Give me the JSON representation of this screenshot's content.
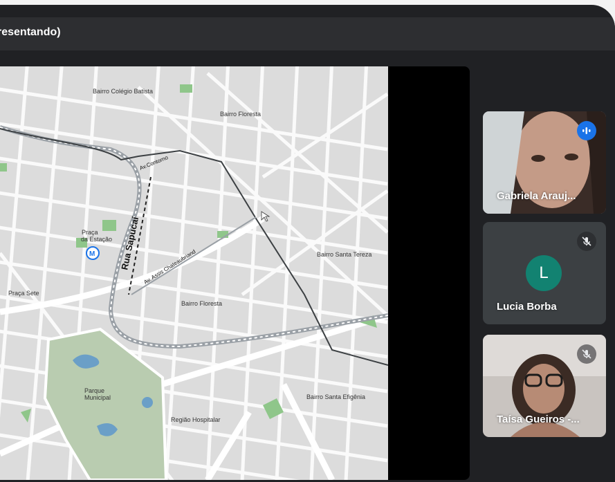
{
  "window": {
    "title": "resentando)"
  },
  "map": {
    "labels": {
      "colegio_batista": "Bairro Colégio Batista",
      "floresta_top": "Bairro Floresta",
      "av_contorno": "Av.Contorno",
      "rua_sapucai": "Rua Sapucaí",
      "praca_estacao": [
        "Praça",
        "da Estação"
      ],
      "metro": "M",
      "av_assis": "Av. Assis Chateaubriand",
      "santa_tereza": "Bairro Santa Tereza",
      "praca_sete": "Praça Sete",
      "floresta_mid": "Bairro Floresta",
      "parque": [
        "Parque",
        "Municipal"
      ],
      "santa_efigenia": "Bairro Santa Efigênia",
      "regiao_hospitalar": "Região Hospitalar"
    }
  },
  "participants": [
    {
      "name": "Gabriela Arauj...",
      "speaking": true,
      "icon": "speaking-icon"
    },
    {
      "name": "Lucia Borba",
      "initial": "L",
      "muted": true,
      "icon": "mic-off-icon",
      "avatar_color": "#128271"
    },
    {
      "name": "Taísa Gueiros -...",
      "muted": true,
      "icon": "mic-off-icon"
    }
  ],
  "colors": {
    "accent": "#1a73e8",
    "active_border": "#7baaf7",
    "background": "#202124"
  }
}
